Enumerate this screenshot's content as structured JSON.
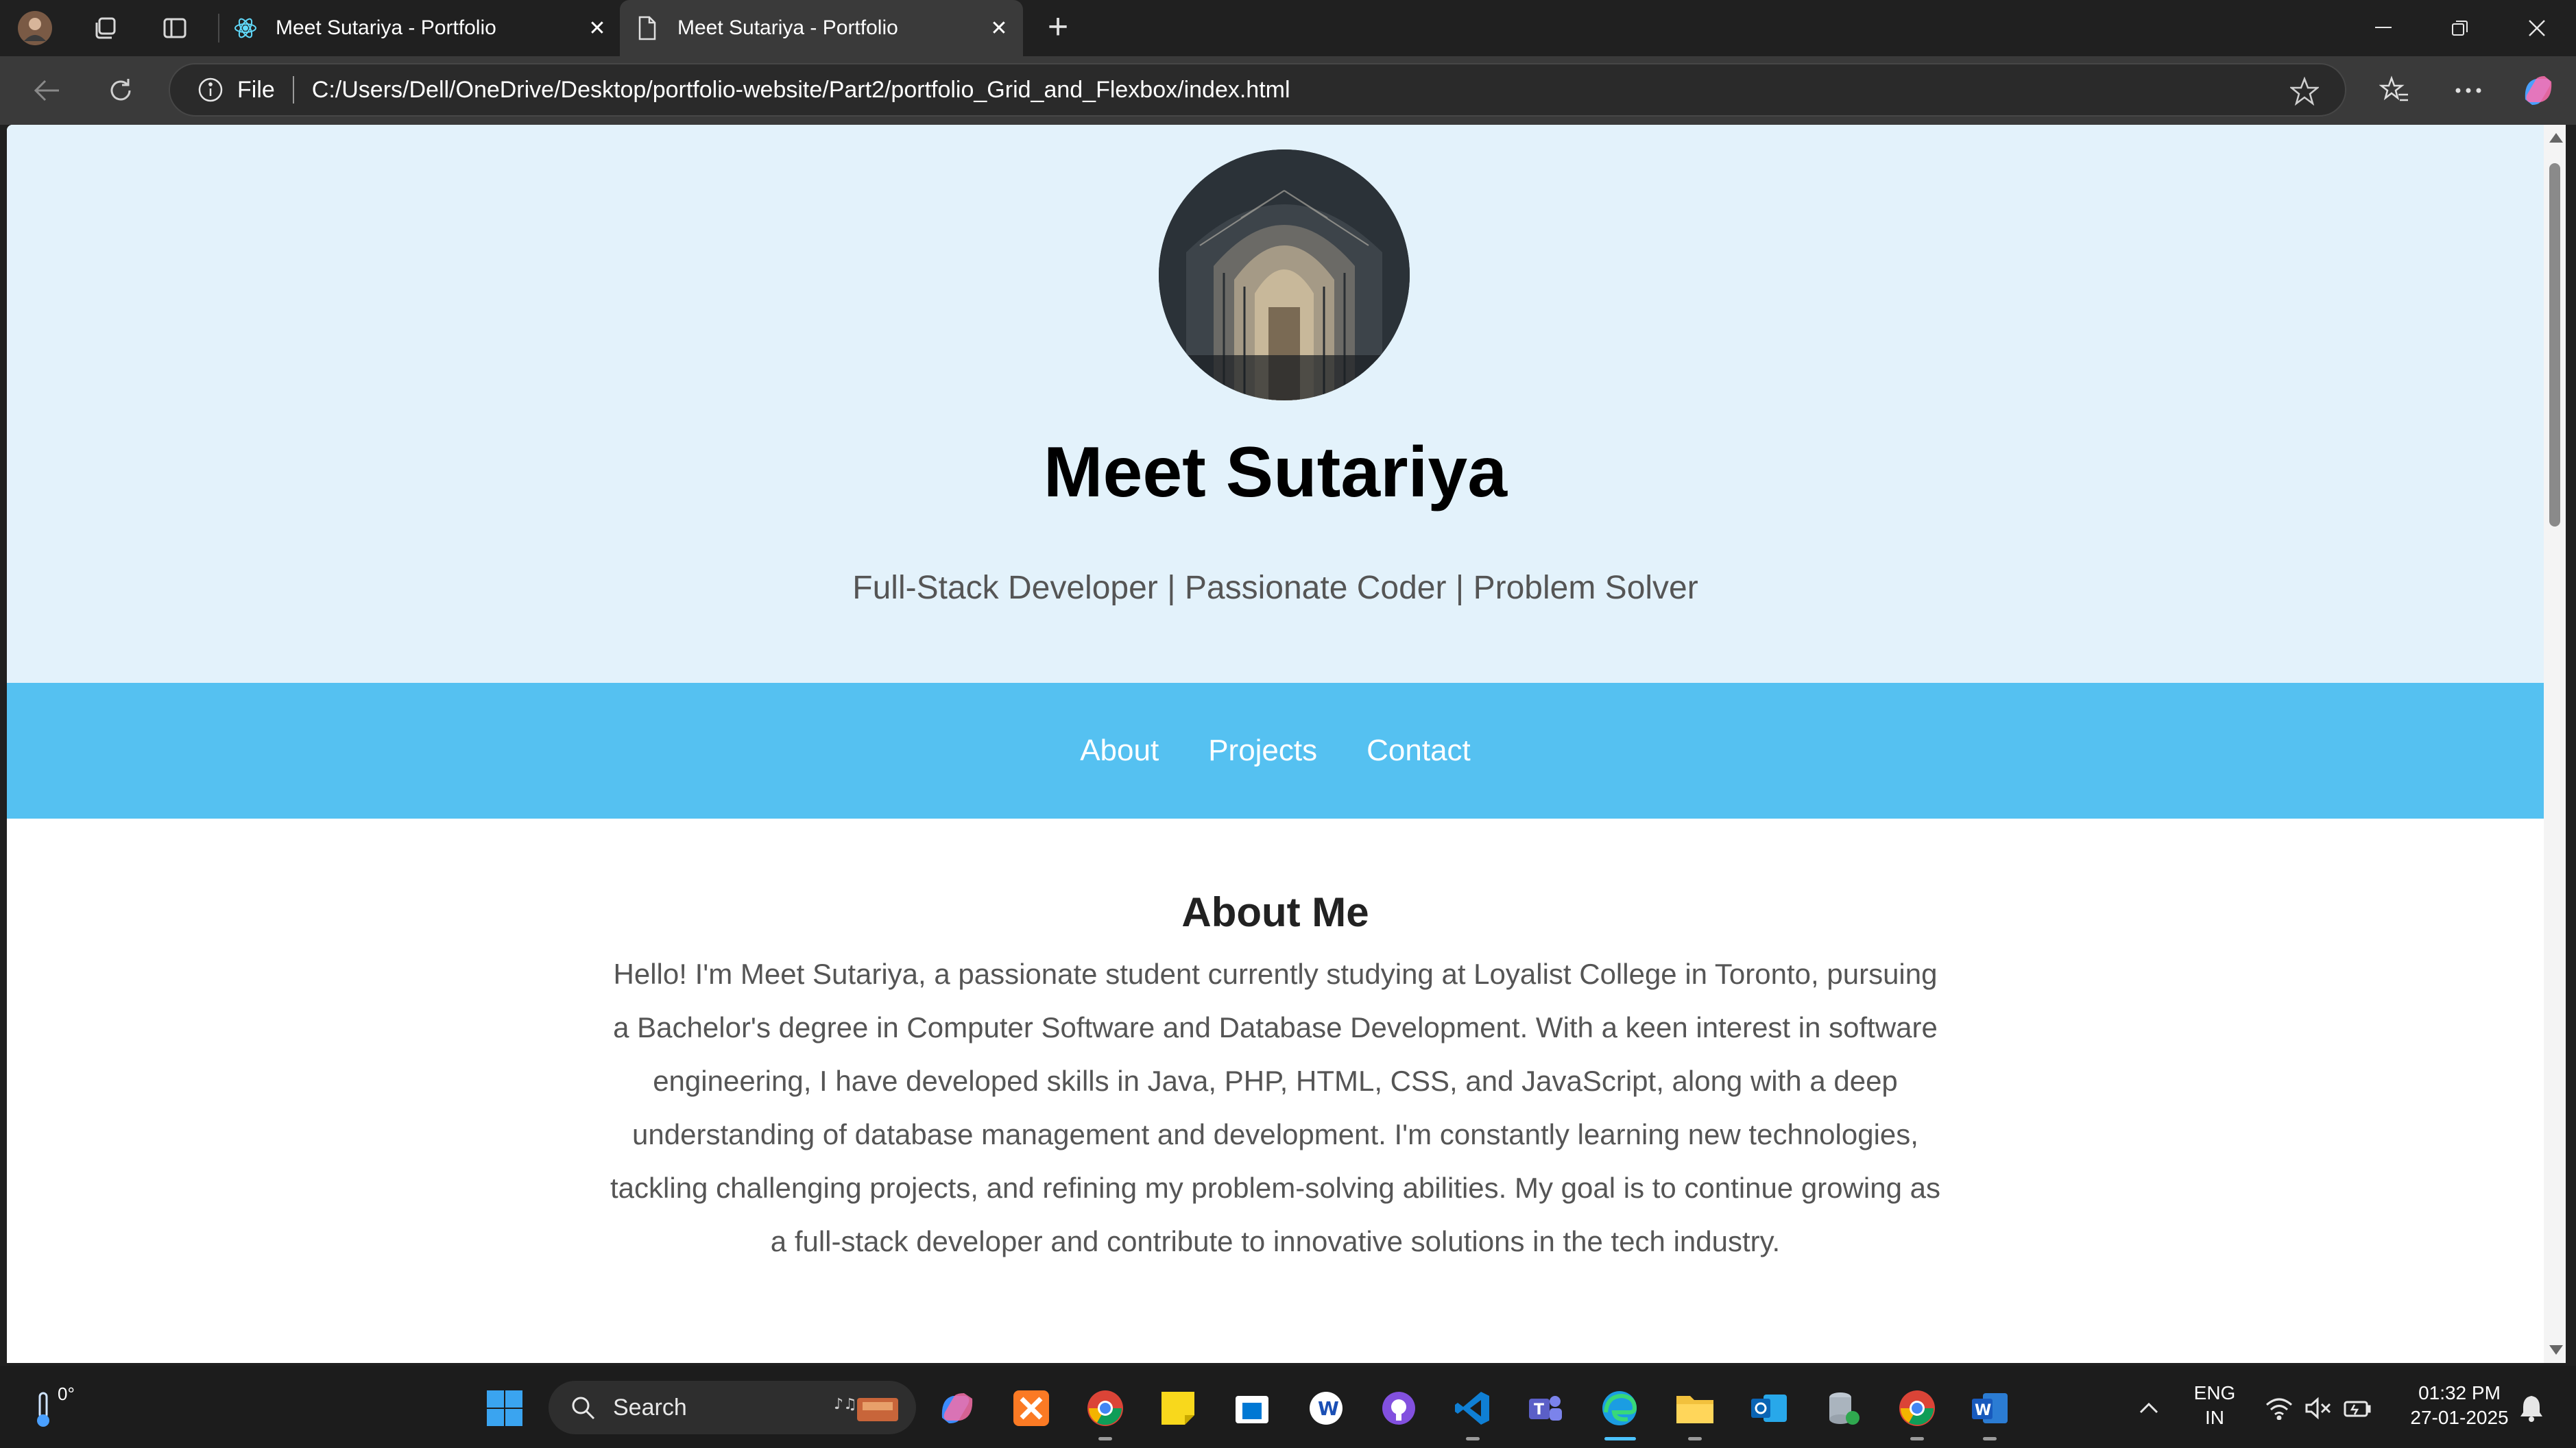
{
  "browser": {
    "tabs": [
      {
        "title": "Meet Sutariya - Portfolio",
        "active": false
      },
      {
        "title": "Meet Sutariya - Portfolio",
        "active": true
      }
    ],
    "address": {
      "scheme_label": "File",
      "url": "C:/Users/Dell/OneDrive/Desktop/portfolio-website/Part2/portfolio_Grid_and_Flexbox/index.html"
    }
  },
  "page": {
    "name": "Meet Sutariya",
    "tagline": "Full-Stack Developer | Passionate Coder | Problem Solver",
    "nav": [
      "About",
      "Projects",
      "Contact"
    ],
    "about": {
      "heading": "About Me",
      "text": "Hello! I'm Meet Sutariya, a passionate student currently studying at Loyalist College in Toronto, pursuing a Bachelor's degree in Computer Software and Database Development. With a keen interest in software engineering, I have developed skills in Java, PHP, HTML, CSS, and JavaScript, along with a deep understanding of database management and development. I'm constantly learning new technologies, tackling challenging projects, and refining my problem-solving abilities. My goal is to continue growing as a full-stack developer and contribute to innovative solutions in the tech industry."
    },
    "colors": {
      "hero_bg": "#e3f2fb",
      "nav_bg": "#55c1f1",
      "nav_text": "#ffffff"
    }
  },
  "taskbar": {
    "weather_temp": "0°",
    "search_placeholder": "Search",
    "lang_line1": "ENG",
    "lang_line2": "IN",
    "time": "01:32 PM",
    "date": "27-01-2025"
  }
}
